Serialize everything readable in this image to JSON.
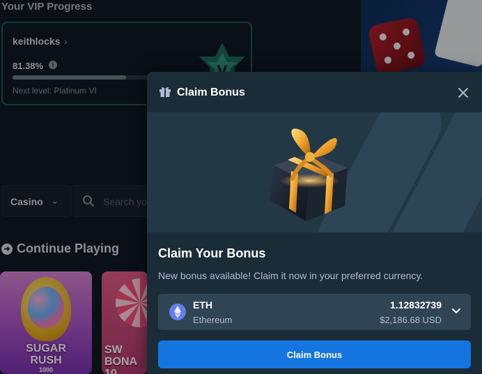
{
  "background": {
    "vip_title": "Your VIP Progress",
    "vip_card": {
      "username": "keithlocks",
      "progress_text": "81.38%",
      "progress_fraction": 0.8138,
      "next_level": "Next level: Platinum VI"
    },
    "casino_dropdown": {
      "label": "Casino"
    },
    "search": {
      "placeholder": "Search your game"
    },
    "continue_playing": "Continue Playing",
    "games": [
      {
        "title_line1": "SUGAR",
        "title_line2": "RUSH",
        "subtitle": "1000"
      },
      {
        "title_line1": "SW",
        "title_line2": "BONA",
        "subtitle": "10"
      }
    ]
  },
  "modal": {
    "title": "Claim Bonus",
    "heading": "Claim Your Bonus",
    "description": "New bonus available! Claim it now in your preferred currency.",
    "currency": {
      "code": "ETH",
      "name": "Ethereum",
      "amount": "1.12832739",
      "usd_value": "$2,186.68 USD",
      "icon": "ethereum-icon"
    },
    "claim_button": "Claim Bonus",
    "close_icon": "close-icon",
    "title_icon": "gift-icon"
  },
  "colors": {
    "primary_button": "#1475e1",
    "modal_bg": "#1a2c38",
    "row_bg": "#2f4553",
    "secondary_text": "#b1bad3",
    "vip_border": "#2c5a4e"
  }
}
